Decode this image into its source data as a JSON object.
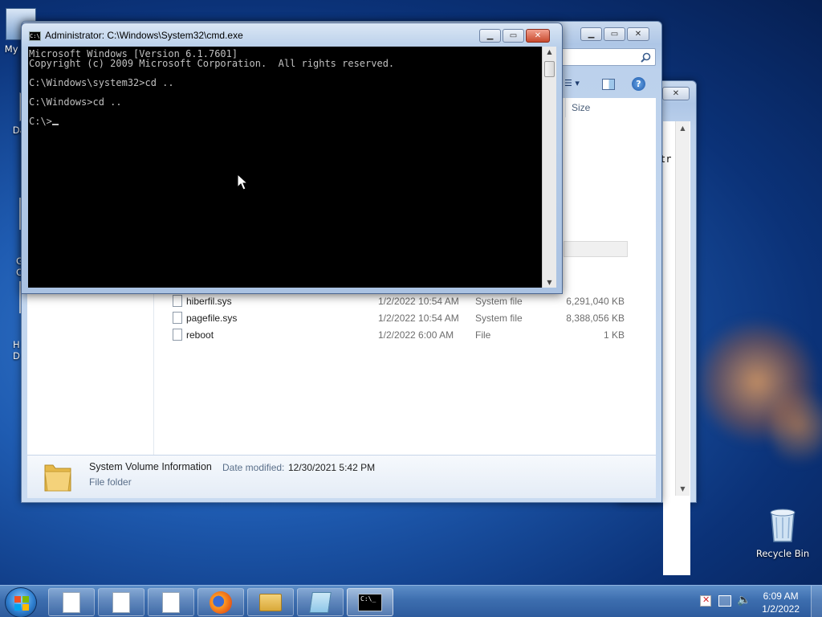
{
  "desktop": {
    "icons": [
      {
        "label": "My C"
      },
      {
        "label": "Dat"
      },
      {
        "label": "G\nC"
      },
      {
        "label": "H\nD"
      }
    ],
    "recycle_bin_label": "Recycle Bin"
  },
  "explorer": {
    "columns": {
      "size": "Size"
    },
    "files": [
      {
        "name": "hiberfil.sys",
        "date": "1/2/2022 10:54 AM",
        "type": "System file",
        "size": "6,291,040 KB"
      },
      {
        "name": "pagefile.sys",
        "date": "1/2/2022 10:54 AM",
        "type": "System file",
        "size": "8,388,056 KB"
      },
      {
        "name": "reboot",
        "date": "1/2/2022 6:00 AM",
        "type": "File",
        "size": "1 KB"
      }
    ],
    "details": {
      "name": "System Volume Information",
      "modified_label": "Date modified:",
      "modified_value": "12/30/2021 5:42 PM",
      "type": "File folder"
    }
  },
  "behind_window": {
    "fragment_text": "tr"
  },
  "cmd": {
    "title": "Administrator: C:\\Windows\\System32\\cmd.exe",
    "lines": [
      "Microsoft Windows [Version 6.1.7601]",
      "Copyright (c) 2009 Microsoft Corporation.  All rights reserved.",
      "",
      "C:\\Windows\\system32>cd ..",
      "",
      "C:\\Windows>cd ..",
      "",
      "C:\\>"
    ]
  },
  "taskbar": {
    "clock_time": "6:09 AM",
    "clock_date": "1/2/2022"
  }
}
